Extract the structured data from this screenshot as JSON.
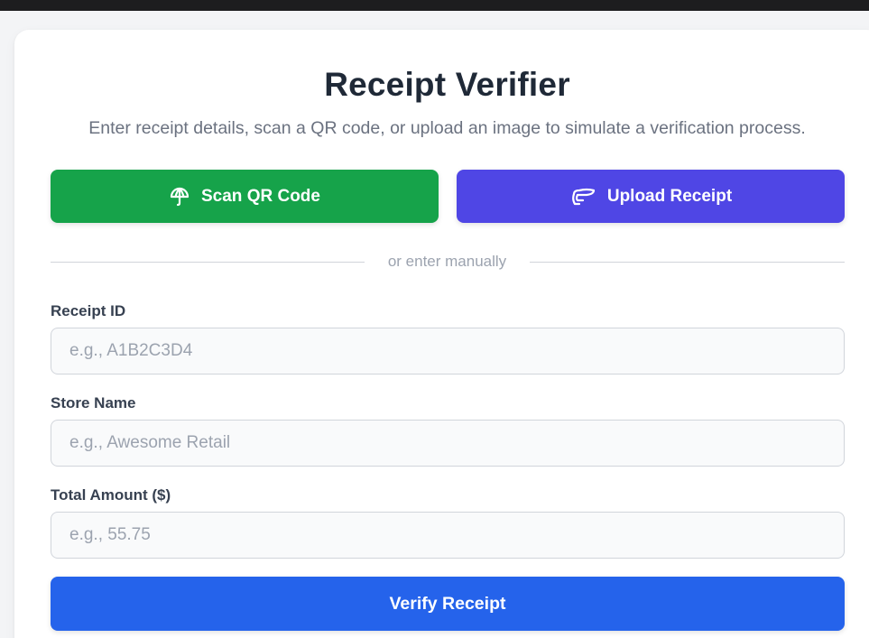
{
  "header": {
    "title": "Receipt Verifier",
    "subtitle": "Enter receipt details, scan a QR code, or upload an image to simulate a verification process."
  },
  "actions": {
    "scan_label": "Scan QR Code",
    "scan_icon": "umbrella-icon",
    "scan_color": "#16a34a",
    "upload_label": "Upload Receipt",
    "upload_icon": "cap-icon",
    "upload_color": "#4f46e5"
  },
  "divider": {
    "text": "or enter manually"
  },
  "form": {
    "receipt_id": {
      "label": "Receipt ID",
      "placeholder": "e.g., A1B2C3D4",
      "value": ""
    },
    "store_name": {
      "label": "Store Name",
      "placeholder": "e.g., Awesome Retail",
      "value": ""
    },
    "total_amount": {
      "label": "Total Amount ($)",
      "placeholder": "e.g., 55.75",
      "value": ""
    },
    "submit_label": "Verify Receipt",
    "submit_color": "#2563eb"
  }
}
